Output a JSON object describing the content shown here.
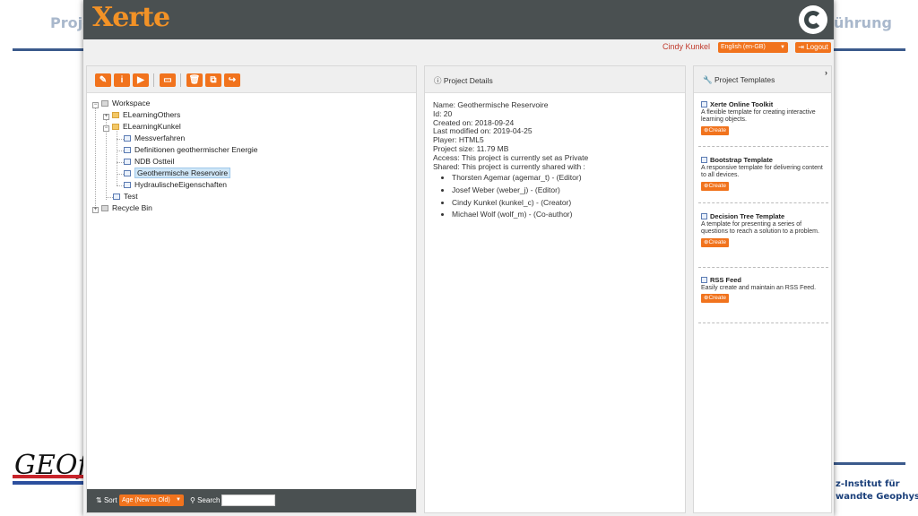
{
  "slide": {
    "left_title": "Proje",
    "right_title": "ührung",
    "logo_left": "GEOfa",
    "institute_line1": "z-Institut für",
    "institute_line2": "wandte Geophysik"
  },
  "app": {
    "logo": "Xerte",
    "username": "Cindy Kunkel",
    "language": "English (en-GB)",
    "logout": "Logout"
  },
  "toolbar": {
    "icons": [
      "edit-icon",
      "info-icon",
      "play-icon",
      "folder-icon",
      "delete-icon",
      "duplicate-icon",
      "share-icon"
    ]
  },
  "tree": {
    "workspace": "Workspace",
    "elearning_others": "ELearningOthers",
    "elearning_kunkel": "ELearningKunkel",
    "items": [
      "Messverfahren",
      "Definitionen geothermischer Energie",
      "NDB Ostteil",
      "Geothermische Reservoire",
      "HydraulischeEigenschaften"
    ],
    "selected": "Geothermische Reservoire",
    "test": "Test",
    "recycle": "Recycle Bin"
  },
  "footer": {
    "sort_label": "Sort",
    "sort_value": "Age (New to Old)",
    "search_label": "Search",
    "search_value": ""
  },
  "details": {
    "title": "Project Details",
    "name": "Name: Geothermische Reservoire",
    "id": "Id: 20",
    "created": "Created on: 2018-09-24",
    "modified": "Last modified on: 2019-04-25",
    "player": "Player: HTML5",
    "size": "Project size: 11.79 MB",
    "access": "Access: This project is currently set as Private",
    "shared": "Shared: This project is currently shared with :",
    "shared_with": [
      "Thorsten Agemar (agemar_t) - (Editor)",
      "Josef Weber (weber_j) - (Editor)",
      "Cindy Kunkel (kunkel_c) - (Creator)",
      "Michael Wolf (wolf_m) - (Co-author)"
    ]
  },
  "templates": {
    "title": "Project Templates",
    "create_label": "Create",
    "items": [
      {
        "name": "Xerte Online Toolkit",
        "desc": "A flexible template for creating interactive learning objects."
      },
      {
        "name": "Bootstrap Template",
        "desc": "A responsive template for delivering content to all devices."
      },
      {
        "name": "Decision Tree Template",
        "desc": "A template for presenting a series of questions to reach a solution to a problem."
      },
      {
        "name": "RSS Feed",
        "desc": "Easily create and maintain an RSS Feed."
      }
    ]
  }
}
